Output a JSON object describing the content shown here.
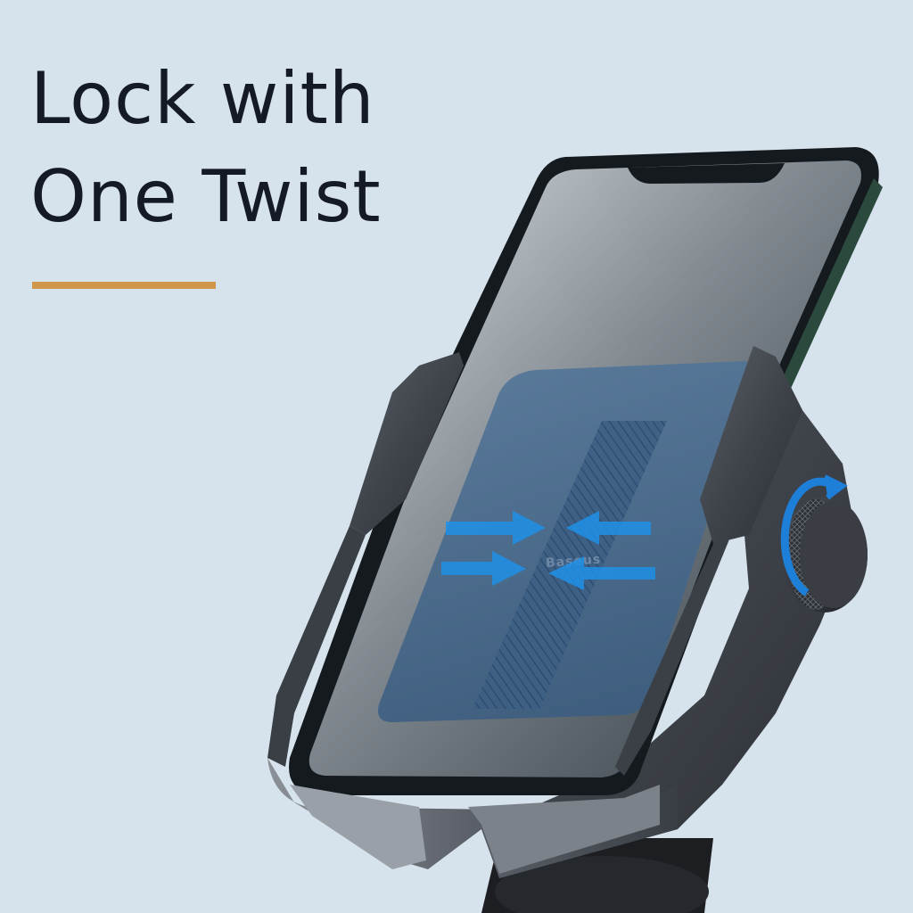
{
  "headline": {
    "line1": "Lock with",
    "line2": "One Twist"
  },
  "brand_mark": "Baseus",
  "colors": {
    "background": "#d6e2ec",
    "headline": "#141a26",
    "accent_rule": "#cf974b",
    "arrows": "#1e90e6",
    "rotation_ring": "#1e7fd8",
    "holder_metal": "#4a4f57"
  },
  "icons": {
    "grip_arrows": "inward-arrows-icon",
    "twist_indicator": "rotate-arrow-icon"
  }
}
